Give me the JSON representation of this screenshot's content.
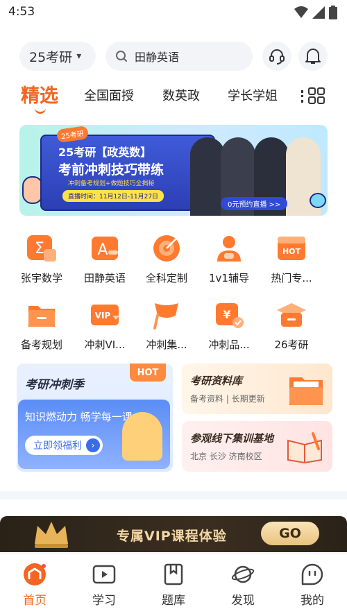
{
  "status_bar": {
    "time": "4:53"
  },
  "header": {
    "exam_select": "25考研",
    "search_text": "田静英语"
  },
  "tabs": [
    {
      "label": "精选",
      "active": true
    },
    {
      "label": "全国面授"
    },
    {
      "label": "数英政"
    },
    {
      "label": "学长学姐"
    }
  ],
  "banner": {
    "badge": "25考研",
    "title_line1": "25考研【政英数】",
    "title_line2": "考前冲刺技巧带练",
    "subtitle": "冲刺备考规划+做题技巧全揭秘",
    "time_text": "直播时间：11月12日-11月27日",
    "cta": "0元预约直播 >>"
  },
  "features": [
    {
      "label": "张宇数学",
      "icon": "sigma-icon"
    },
    {
      "label": "田静英语",
      "icon": "letter-a-icon"
    },
    {
      "label": "全科定制",
      "icon": "target-icon"
    },
    {
      "label": "1v1辅导",
      "icon": "tutor-icon"
    },
    {
      "label": "热门专...",
      "icon": "hot-icon"
    },
    {
      "label": "备考规划",
      "icon": "folder-icon"
    },
    {
      "label": "冲刺VI...",
      "icon": "vip-ticket-icon"
    },
    {
      "label": "冲刺集...",
      "icon": "flag-icon"
    },
    {
      "label": "冲刺品...",
      "icon": "yuan-bag-icon"
    },
    {
      "label": "26考研",
      "icon": "graduation-icon"
    }
  ],
  "promo_left": {
    "title": "考研冲刺季",
    "hot": "HOT",
    "subtitle": "知识燃动力 畅学每一课",
    "button": "立即领福利"
  },
  "promo_right_1": {
    "title": "考研资料库",
    "subtitle": "备考资料 | 长期更新"
  },
  "promo_right_2": {
    "title": "参观线下集训基地",
    "subtitle": "北京  长沙  济南校区"
  },
  "vip_banner": {
    "text": "专属VIP课程体验",
    "button": "GO"
  },
  "tabbar": [
    {
      "label": "首页",
      "icon": "home-icon",
      "active": true
    },
    {
      "label": "学习",
      "icon": "play-icon"
    },
    {
      "label": "题库",
      "icon": "bookmark-icon"
    },
    {
      "label": "发现",
      "icon": "planet-icon"
    },
    {
      "label": "我的",
      "icon": "profile-icon"
    }
  ],
  "colors": {
    "accent": "#f26522",
    "icon_orange": "#ff7a2f"
  }
}
